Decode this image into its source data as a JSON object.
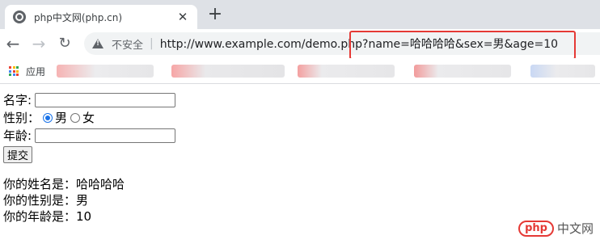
{
  "browser": {
    "tab": {
      "title": "php中文网(php.cn)",
      "close": "✕"
    },
    "new_tab": "+",
    "nav": {
      "back": "←",
      "forward": "→",
      "reload": "↻"
    },
    "omnibox": {
      "security_label": "不安全",
      "separator": "|",
      "url": "http://www.example.com/demo.php?name=哈哈哈哈&sex=男&age=10"
    },
    "bookmarks": {
      "apps_label": "应用"
    }
  },
  "form": {
    "name_label": "名字:",
    "name_value": "",
    "sex_label": "性别：",
    "sex_options": [
      "男",
      "女"
    ],
    "sex_selected": "男",
    "age_label": "年龄:",
    "age_value": "",
    "submit_label": "提交"
  },
  "result": {
    "name_line": "你的姓名是：哈哈哈哈",
    "sex_line": "你的性别是：男",
    "age_line": "你的年龄是：10"
  },
  "watermark": {
    "logo": "php",
    "text": "中文网"
  },
  "colors": {
    "highlight": "#e53935",
    "radio_checked": "#1a73e8",
    "tabstrip": "#dee1e6"
  }
}
